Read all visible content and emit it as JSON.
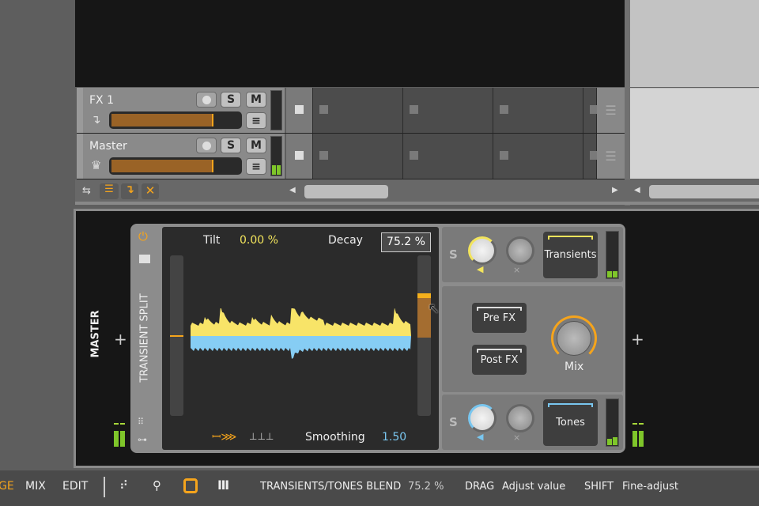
{
  "tracks": [
    {
      "name": "FX 1",
      "icon": "return-arrow-icon",
      "solo": "S",
      "mute": "M",
      "volume": 0.78
    },
    {
      "name": "Master",
      "icon": "crown-icon",
      "solo": "S",
      "mute": "M",
      "volume": 0.78
    }
  ],
  "device_panel": {
    "track_label": "MASTER",
    "device_name": "TRANSIENT SPLIT",
    "tilt_label": "Tilt",
    "tilt_value": "0.00 %",
    "decay_label": "Decay",
    "decay_value": "75.2 %",
    "smoothing_label": "Smoothing",
    "smoothing_value": "1.50",
    "transients": {
      "solo": "S",
      "label": "Transients",
      "color": "#f2e45c"
    },
    "tones": {
      "solo": "S",
      "label": "Tones",
      "color": "#79c6ef"
    },
    "pre_fx": "Pre FX",
    "post_fx": "Post FX",
    "mix_label": "Mix",
    "mix_value": 0.75
  },
  "status_bar": {
    "modes": [
      "GE",
      "MIX",
      "EDIT"
    ],
    "param_label": "TRANSIENTS/TONES BLEND",
    "param_value": "75.2 %",
    "hint1_key": "DRAG",
    "hint1_text": "Adjust value",
    "hint2_key": "SHIFT",
    "hint2_text": "Fine-adjust"
  },
  "colors": {
    "accent": "#f5a41c",
    "transients": "#f2e45c",
    "tones": "#79c6ef",
    "meter": "#7fc62a"
  }
}
